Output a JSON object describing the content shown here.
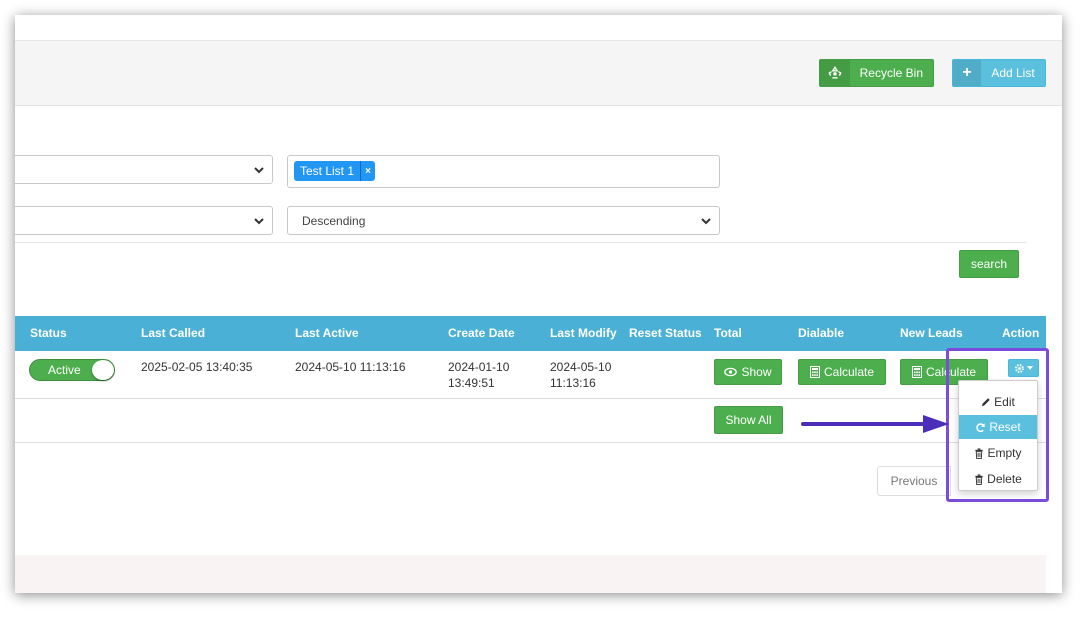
{
  "header": {
    "recycle_bin": {
      "label": "Recycle Bin",
      "icon": "recycle-icon"
    },
    "add_list": {
      "label": "Add List",
      "icon": "plus-icon"
    }
  },
  "filters": {
    "select_1": {
      "value": ""
    },
    "list_tags": [
      "Test List 1"
    ],
    "select_2": {
      "value": ""
    },
    "order": {
      "value": "Descending"
    },
    "search_label": "search"
  },
  "table": {
    "headers": {
      "status": "Status",
      "last_called": "Last Called",
      "last_active": "Last Active",
      "create_date": "Create Date",
      "last_modify": "Last Modify",
      "reset_status": "Reset Status",
      "total": "Total",
      "dialable": "Dialable",
      "new_leads": "New Leads",
      "action": "Action"
    },
    "row": {
      "status": "Active",
      "last_called": "2025-02-05 13:40:35",
      "last_active": "2024-05-10 11:13:16",
      "create_date_1": "2024-01-10",
      "create_date_2": "13:49:51",
      "last_modify_1": "2024-05-10",
      "last_modify_2": "11:13:16",
      "total_btn": "Show",
      "dialable_btn": "Calculate",
      "new_leads_btn": "Calculate"
    },
    "show_all": "Show All"
  },
  "action_menu": {
    "items": [
      {
        "label": "Edit",
        "icon": "pencil-icon"
      },
      {
        "label": "Reset",
        "icon": "refresh-icon",
        "active": true
      },
      {
        "label": "Empty",
        "icon": "trash-icon"
      },
      {
        "label": "Delete",
        "icon": "trash-icon"
      }
    ]
  },
  "pagination": {
    "previous": "Previous"
  },
  "colors": {
    "primary_green": "#4cae4c",
    "info_blue": "#5bc0de",
    "table_header": "#4bb0d5",
    "tag_blue": "#2196f3",
    "highlight_purple": "#7b4cdb"
  }
}
